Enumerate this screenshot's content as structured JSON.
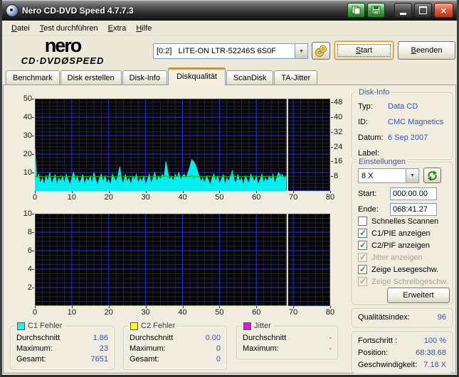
{
  "window": {
    "title": "Nero CD-DVD Speed 4.7.7.3"
  },
  "icons": {
    "app": "nero-disc-icon",
    "titlebar": [
      "copy-results-icon",
      "save-results-icon",
      "minimize-icon",
      "maximize-icon",
      "close-x-icon"
    ],
    "drive_arrow": "chevron-down-icon",
    "eject": "disc-stack-icon",
    "refresh": "refresh-arrows-icon"
  },
  "menu": {
    "items": [
      {
        "u": "D",
        "rest": "atei"
      },
      {
        "u": "T",
        "rest": "est durchführen"
      },
      {
        "u": "E",
        "rest": "xtra"
      },
      {
        "u": "H",
        "rest": "ilfe"
      }
    ]
  },
  "logo": {
    "brand": "nero",
    "product_left": "CD·DVD",
    "product_slash": "Ø",
    "product_right": "SPEED"
  },
  "toolbar": {
    "drive": "[0:2]   LITE-ON LTR-52246S 6S0F",
    "start": {
      "u": "S",
      "rest": "tart"
    },
    "quit": {
      "u": "B",
      "rest": "eenden"
    }
  },
  "tabs": {
    "items": [
      "Benchmark",
      "Disk erstellen",
      "Disk-Info",
      "Diskqualität",
      "ScanDisk",
      "TA-Jitter"
    ],
    "active": "Diskqualität"
  },
  "disk_info": {
    "title": "Disk-Info",
    "rows": [
      {
        "label": "Typ:",
        "value": "Data CD"
      },
      {
        "label": "ID:",
        "value": "CMC Magnetics"
      },
      {
        "label": "Datum:",
        "value": "6 Sep 2007"
      },
      {
        "label": "Label:",
        "value": ""
      }
    ]
  },
  "settings": {
    "title": "Einstellungen",
    "speed_select": "8 X",
    "start_label": "Start:",
    "start_value": "000:00.00",
    "end_label": "Ende:",
    "end_value": "068:41.27",
    "checkboxes": [
      {
        "label": "Schnelles Scannen",
        "checked": false,
        "disabled": false
      },
      {
        "label": "C1/PIE anzeigen",
        "checked": true,
        "disabled": false
      },
      {
        "label": "C2/PIF anzeigen",
        "checked": true,
        "disabled": false
      },
      {
        "label": "Jitter anzeigen",
        "checked": true,
        "disabled": true
      },
      {
        "label": "Zeige Lesegeschw.",
        "checked": true,
        "disabled": false
      },
      {
        "label": "Zeige Schreibgeschw.",
        "checked": true,
        "disabled": true
      }
    ],
    "advanced_button": "Erweitert"
  },
  "quality_index": {
    "label": "Qualitätsindex:",
    "value": "96"
  },
  "progress": {
    "rows": [
      {
        "label": "Fortschritt :",
        "value": "100 %"
      },
      {
        "label": "Position:",
        "value": "68:38.68"
      },
      {
        "label": "Geschwindigkeit:",
        "value": "7.18 X"
      }
    ]
  },
  "stats": [
    {
      "title": "C1 Fehler",
      "color": "#00ffff",
      "rows": [
        {
          "label": "Durchschnitt",
          "value": "1.86"
        },
        {
          "label": "Maximum:",
          "value": "23"
        },
        {
          "label": "Gesamt:",
          "value": "7651"
        }
      ]
    },
    {
      "title": "C2 Fehler",
      "color": "#ffff00",
      "rows": [
        {
          "label": "Durchschnitt",
          "value": "0.00"
        },
        {
          "label": "Maximum:",
          "value": "0"
        },
        {
          "label": "Gesamt:",
          "value": "0"
        }
      ]
    },
    {
      "title": "Jitter",
      "color": "#ff00ff",
      "rows": [
        {
          "label": "Durchschnitt",
          "value": "-"
        },
        {
          "label": "Maximum:",
          "value": "-"
        }
      ]
    }
  ],
  "chart_data": [
    {
      "type": "area",
      "title": "C1 errors vs position with read speed overlay",
      "x_range": [
        0,
        80
      ],
      "x_ticks": [
        0,
        10,
        20,
        30,
        40,
        50,
        60,
        70,
        80
      ],
      "x_minor_step": 2,
      "y_range": [
        0,
        50
      ],
      "y_ticks_left": [
        10,
        20,
        30,
        40,
        50
      ],
      "y_minor_step": 2,
      "y_ticks_right": [
        8,
        16,
        24,
        32,
        40,
        48
      ],
      "marker_x": 68.4,
      "colors": {
        "bg": "#070707",
        "grid_major": "#2d2dd8",
        "grid_minor": "#23233b",
        "marker": "#e8e8e8"
      },
      "series": [
        {
          "name": "C1 Fehler",
          "render": "area",
          "color": "#00efef",
          "x_step": 0.5,
          "values": [
            23,
            6,
            9,
            4,
            7,
            3,
            8,
            5,
            10,
            4,
            6,
            9,
            3,
            7,
            5,
            8,
            4,
            9,
            6,
            3,
            7,
            10,
            5,
            8,
            4,
            6,
            9,
            3,
            7,
            5,
            8,
            4,
            10,
            6,
            3,
            7,
            9,
            5,
            8,
            4,
            6,
            3,
            9,
            7,
            5,
            8,
            13,
            6,
            4,
            9,
            5,
            7,
            3,
            8,
            6,
            9,
            4,
            7,
            5,
            8,
            3,
            6,
            9,
            4,
            7,
            10,
            5,
            8,
            6,
            9,
            7,
            16,
            10,
            6,
            8,
            5,
            9,
            7,
            10,
            6,
            8,
            9,
            7,
            10,
            13,
            17,
            16,
            14,
            11,
            8,
            5,
            7,
            4,
            8,
            6,
            3,
            7,
            9,
            5,
            8,
            4,
            6,
            9,
            3,
            7,
            5,
            8,
            11,
            6,
            4,
            9,
            5,
            7,
            3,
            8,
            6,
            4,
            9,
            7,
            5,
            8,
            3,
            6,
            9,
            4,
            7,
            5,
            8,
            6,
            9,
            4,
            7,
            10,
            8,
            9,
            7,
            8
          ]
        },
        {
          "name": "Lesegeschwindigkeit",
          "render": "line",
          "color": "#00c400",
          "x_step": 0.5,
          "values": [
            7.8,
            7.9,
            7.7,
            8.0,
            7.8,
            7.6,
            7.9,
            8.1,
            7.7,
            7.8,
            8.0,
            7.6,
            7.9,
            7.8,
            8.1,
            7.7,
            7.8,
            7.9,
            7.7,
            8.0,
            7.8,
            7.6,
            7.9,
            8.1,
            7.7,
            7.8,
            8.0,
            7.6,
            7.9,
            7.8,
            8.1,
            7.7,
            7.8,
            7.9,
            7.7,
            8.0,
            7.8,
            7.6,
            7.9,
            8.1,
            7.7,
            7.8,
            8.0,
            7.6,
            7.9,
            7.8,
            8.4,
            7.7,
            7.8,
            7.9,
            7.7,
            8.0,
            7.8,
            7.6,
            7.9,
            8.1,
            7.7,
            7.8,
            8.0,
            7.6,
            7.9,
            7.8,
            8.1,
            7.7,
            7.8,
            7.9,
            7.7,
            8.0,
            7.8,
            7.6,
            7.9,
            8.3,
            7.7,
            7.8,
            8.0,
            7.6,
            7.9,
            7.8,
            8.1,
            7.7,
            7.8,
            7.9,
            7.7,
            8.0,
            7.8,
            8.5,
            7.2,
            8.1,
            7.7,
            7.8,
            8.0,
            7.6,
            7.9,
            7.8,
            8.1,
            7.7,
            7.8,
            7.9,
            7.7,
            8.0,
            7.8,
            7.6,
            7.9,
            8.1,
            7.7,
            7.8,
            8.0,
            9.8,
            7.9,
            7.8,
            8.1,
            7.7,
            7.8,
            7.9,
            7.7,
            8.0,
            7.8,
            7.6,
            7.9,
            8.1,
            7.7,
            7.8,
            8.0,
            7.6,
            7.9,
            7.8,
            8.1,
            7.7,
            7.8,
            7.9,
            7.7,
            8.0,
            7.8,
            8.9,
            7.9,
            8.1,
            7.7
          ]
        }
      ]
    },
    {
      "type": "area",
      "title": "C2 errors vs position",
      "x_range": [
        0,
        80
      ],
      "x_ticks": [
        0,
        10,
        20,
        30,
        40,
        50,
        60,
        70,
        80
      ],
      "x_minor_step": 2,
      "y_range": [
        0,
        10
      ],
      "y_ticks_left": [
        2,
        4,
        6,
        8,
        10
      ],
      "y_minor_step": 0.5,
      "y_ticks_right": [],
      "marker_x": 68.4,
      "colors": {
        "bg": "#070707",
        "grid_major": "#2d2dd8",
        "grid_minor": "#23233b",
        "marker": "#e8e8e8"
      },
      "series": [
        {
          "name": "C2 Fehler",
          "render": "area",
          "color": "#ffff00",
          "x_step": 68.4,
          "values": [
            0,
            0
          ]
        }
      ]
    }
  ]
}
